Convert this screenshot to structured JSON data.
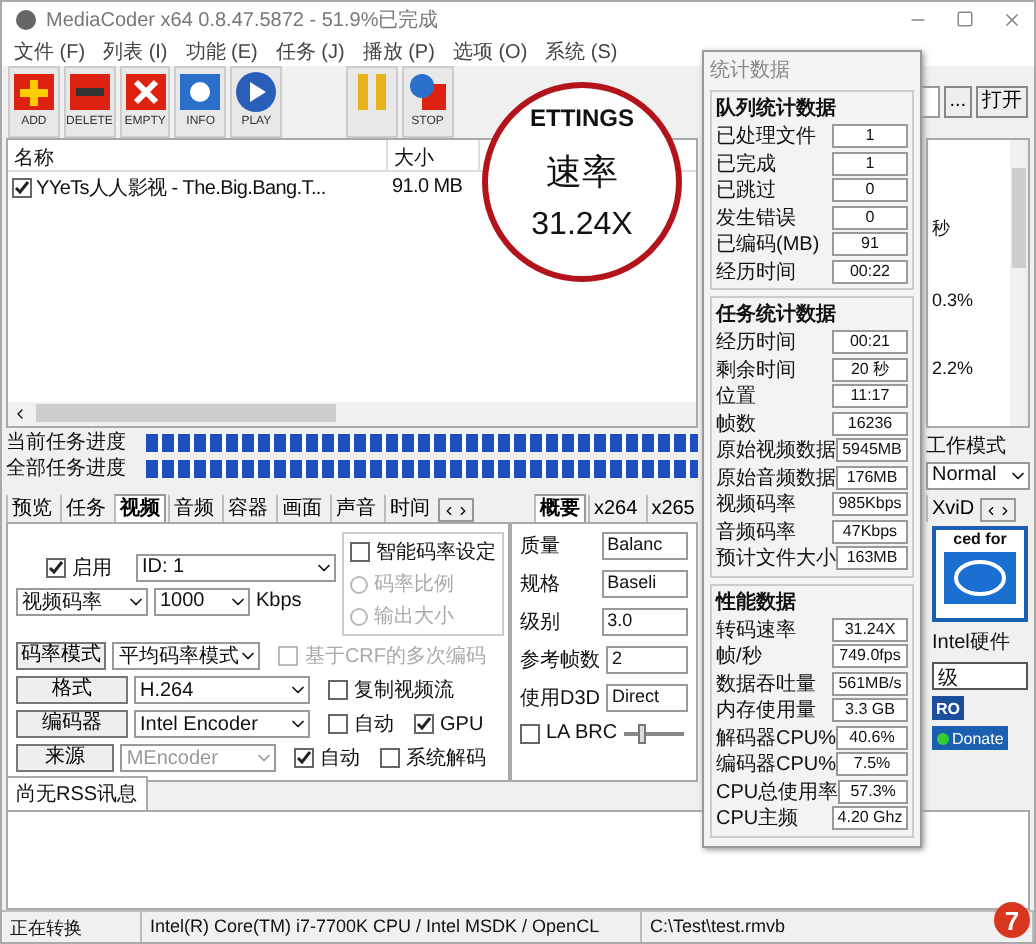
{
  "window": {
    "title": "MediaCoder x64 0.8.47.5872 - 51.9%已完成"
  },
  "menu": [
    "文件 (F)",
    "列表 (I)",
    "功能 (E)",
    "任务 (J)",
    "播放 (P)",
    "选项 (O)",
    "系统 (S)"
  ],
  "toolbar": [
    {
      "kind": "add",
      "label": "ADD"
    },
    {
      "kind": "delete",
      "label": "DELETE"
    },
    {
      "kind": "empty",
      "label": "EMPTY"
    },
    {
      "kind": "info",
      "label": "INFO"
    },
    {
      "kind": "play",
      "label": "PLAY"
    },
    {
      "kind": "pause"
    },
    {
      "kind": "stop",
      "label": "STOP"
    }
  ],
  "output": {
    "browse": "...",
    "open": "打开"
  },
  "magnifier": {
    "tab": "ETTINGS",
    "header": "速率",
    "value": "31.24X"
  },
  "table": {
    "columns": [
      "名称",
      "大小"
    ],
    "rows": [
      {
        "checked": true,
        "name": "YYeTs人人影视 - The.Big.Bang.T...",
        "size": "91.0 MB"
      }
    ]
  },
  "side_panel": [
    "秒",
    "0.3%",
    "2.2%"
  ],
  "progress": [
    {
      "label": "当前任务进度",
      "level": 1
    },
    {
      "label": "全部任务进度",
      "level": 1
    }
  ],
  "work_mode": {
    "label": "工作模式",
    "value": "Normal"
  },
  "tabs_left": [
    {
      "label": "预览",
      "selected": false
    },
    {
      "label": "任务",
      "selected": false
    },
    {
      "label": "视频",
      "selected": true
    },
    {
      "label": "音频",
      "selected": false
    },
    {
      "label": "容器",
      "selected": false
    },
    {
      "label": "画面",
      "selected": false
    },
    {
      "label": "声音",
      "selected": false
    },
    {
      "label": "时间",
      "selected": false
    }
  ],
  "tabs_right": [
    {
      "label": "概要",
      "selected": true
    },
    {
      "label": "x264",
      "selected": false
    },
    {
      "label": "x265",
      "selected": false
    },
    {
      "label": "XviD",
      "selected": false
    }
  ],
  "video": {
    "enable": {
      "label": "启用",
      "checked": true
    },
    "id": "ID: 1",
    "bitrate_type": "视频码率",
    "bitrate": "1000",
    "unit": "Kbps",
    "smart": {
      "label": "智能码率设定",
      "checked": false,
      "options": [
        {
          "label": "码率比例",
          "selected": false
        },
        {
          "label": "输出大小",
          "selected": false
        }
      ]
    },
    "rows": [
      {
        "button": "码率模式",
        "value": "平均码率模式",
        "disabled": false,
        "options": [
          {
            "label": "基于CRF的多次编码",
            "checked": false,
            "disabled": true
          }
        ]
      },
      {
        "button": "格式",
        "value": "H.264",
        "disabled": false,
        "options": [
          {
            "label": "复制视频流",
            "checked": false,
            "disabled": false
          }
        ]
      },
      {
        "button": "编码器",
        "value": "Intel Encoder",
        "disabled": false,
        "options": [
          {
            "label": "自动",
            "checked": false,
            "disabled": false
          },
          {
            "label": "GPU",
            "checked": true,
            "disabled": false
          }
        ]
      },
      {
        "button": "来源",
        "value": "MEncoder",
        "disabled": true,
        "options": [
          {
            "label": "自动",
            "checked": true,
            "disabled": false
          },
          {
            "label": "系统解码",
            "checked": false,
            "disabled": false
          }
        ]
      }
    ]
  },
  "encoder": {
    "fields": [
      {
        "label": "质量",
        "value": "Balanc"
      },
      {
        "label": "规格",
        "value": "Baseli"
      },
      {
        "label": "级别",
        "value": "3.0"
      },
      {
        "label": "参考帧数",
        "value": "2"
      },
      {
        "label": "使用D3D",
        "value": "Direct"
      }
    ],
    "la_brc": {
      "label": "LA BRC",
      "checked": false
    },
    "slider": {
      "level": 0.3
    }
  },
  "hardware": {
    "badge": "ced for",
    "label": "Intel硬件",
    "field": "级",
    "pro": "RO",
    "donate": "Donate"
  },
  "rss": {
    "tab": "尚无RSS讯息"
  },
  "status_bar": [
    "正在转换",
    "Intel(R) Core(TM) i7-7700K CPU  / Intel MSDK / OpenCL",
    "C:\\Test\\test.rmvb"
  ],
  "stats": {
    "title": "统计数据",
    "groups": [
      {
        "title": "队列统计数据",
        "rows": [
          {
            "label": "已处理文件",
            "value": "1"
          },
          {
            "label": "已完成",
            "value": "1"
          },
          {
            "label": "已跳过",
            "value": "0"
          },
          {
            "label": "发生错误",
            "value": "0"
          },
          {
            "label": "已编码(MB)",
            "value": "91"
          },
          {
            "label": "经历时间",
            "value": "00:22"
          }
        ]
      },
      {
        "title": "任务统计数据",
        "rows": [
          {
            "label": "经历时间",
            "value": "00:21"
          },
          {
            "label": "剩余时间",
            "value": "20 秒"
          },
          {
            "label": "位置",
            "value": "11:17"
          },
          {
            "label": "帧数",
            "value": "16236"
          },
          {
            "label": "原始视频数据",
            "value": "5945MB"
          },
          {
            "label": "原始音频数据",
            "value": "176MB"
          },
          {
            "label": "视频码率",
            "value": "985Kbps"
          },
          {
            "label": "音频码率",
            "value": "47Kbps"
          },
          {
            "label": "预计文件大小",
            "value": "163MB"
          }
        ]
      },
      {
        "title": "性能数据",
        "rows": [
          {
            "label": "转码速率",
            "value": "31.24X"
          },
          {
            "label": "帧/秒",
            "value": "749.0fps"
          },
          {
            "label": "数据吞吐量",
            "value": "561MB/s"
          },
          {
            "label": "内存使用量",
            "value": "3.3 GB"
          },
          {
            "label": "解码器CPU%",
            "value": "40.6%"
          },
          {
            "label": "编码器CPU%",
            "value": "7.5%"
          },
          {
            "label": "CPU总使用率",
            "value": "57.3%"
          },
          {
            "label": "CPU主频",
            "value": "4.20 Ghz"
          }
        ]
      }
    ]
  },
  "page_badge": "7"
}
